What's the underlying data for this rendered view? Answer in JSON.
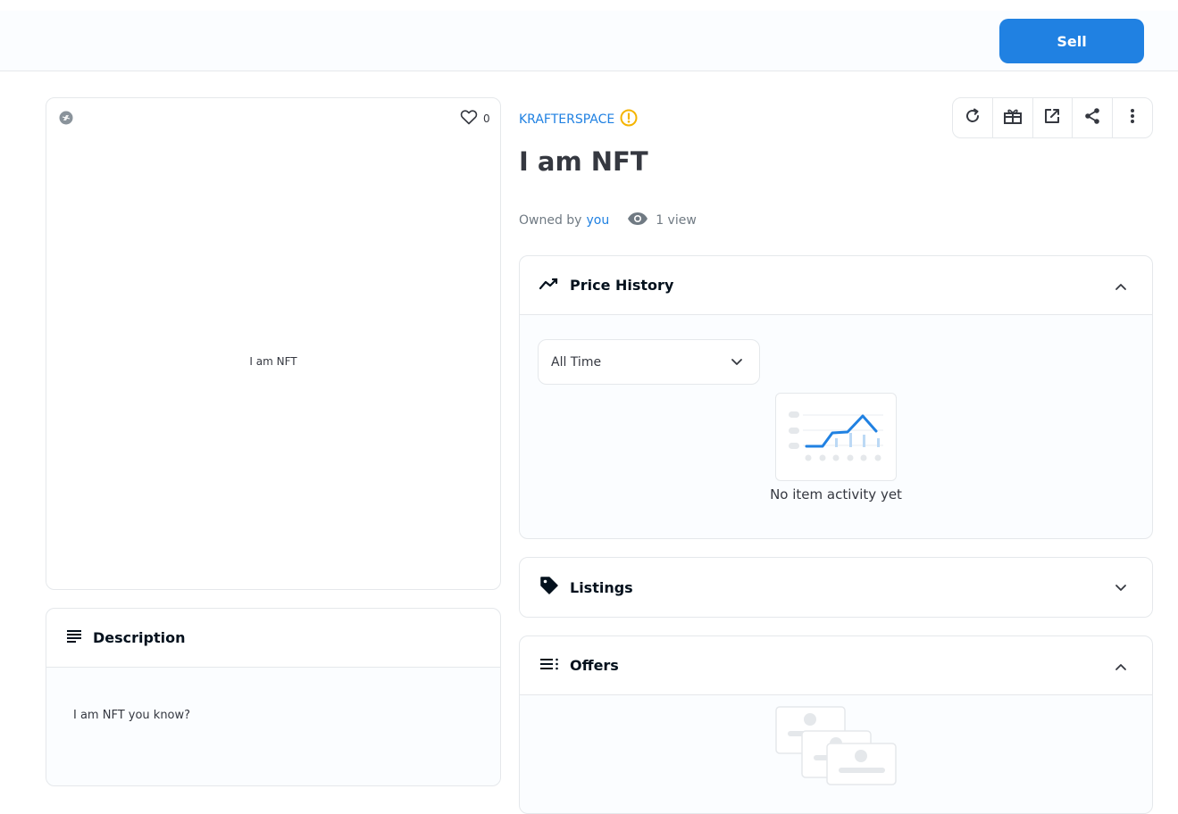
{
  "actionbar": {
    "sell_label": "Sell"
  },
  "media": {
    "favorite_count": "0",
    "image_text": "I am NFT"
  },
  "description": {
    "header": "Description",
    "text": "I am NFT you know?"
  },
  "item": {
    "collection": "KRAFTERSPACE",
    "title": "I am NFT",
    "owned_by_label": "Owned by",
    "owner": "you",
    "views": "1 view"
  },
  "toolbar": {
    "icons": [
      "refresh-icon",
      "transfer-icon",
      "external-link-icon",
      "share-icon",
      "more-icon"
    ]
  },
  "price_history": {
    "header": "Price History",
    "period_selected": "All Time",
    "empty_text": "No item activity yet"
  },
  "listings": {
    "header": "Listings"
  },
  "offers": {
    "header": "Offers"
  },
  "colors": {
    "accent": "#2081e2",
    "warning": "#f5b400",
    "text": "#04111d",
    "muted": "#707a83"
  }
}
